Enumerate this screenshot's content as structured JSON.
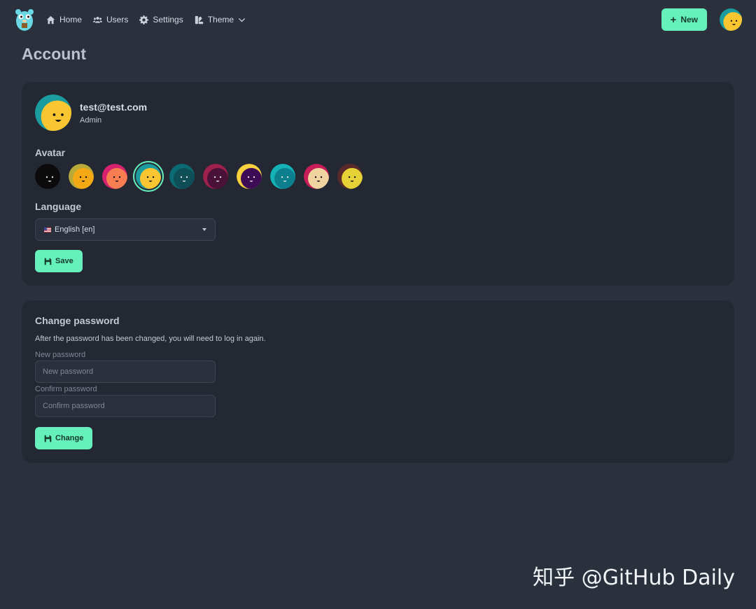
{
  "nav": {
    "logo_icon": "gopher-logo-icon",
    "items": [
      {
        "label": "Home",
        "icon": "home-icon"
      },
      {
        "label": "Users",
        "icon": "users-icon"
      },
      {
        "label": "Settings",
        "icon": "gear-icon"
      },
      {
        "label": "Theme",
        "icon": "palette-icon"
      }
    ],
    "new_button": "New",
    "accent_color": "#66f1bc"
  },
  "page": {
    "title": "Account"
  },
  "profile": {
    "email": "test@test.com",
    "role": "Admin"
  },
  "account": {
    "avatar_label": "Avatar",
    "avatars": [
      {
        "bg": "#0b0b0b",
        "face": "#0b0b0b",
        "accent": "#1a1a1a"
      },
      {
        "bg": "#b7a93a",
        "face": "#f4a814",
        "accent": "#8a8a2c"
      },
      {
        "bg": "#d6216e",
        "face": "#f77d52",
        "accent": "#b51a60"
      },
      {
        "bg": "#1b9da0",
        "face": "#f9c631",
        "accent": "#1b9da0"
      },
      {
        "bg": "#0c6b72",
        "face": "#0e4e57",
        "accent": "#0a8a8a"
      },
      {
        "bg": "#a0214b",
        "face": "#4a1238",
        "accent": "#7a1a45"
      },
      {
        "bg": "#f7d23e",
        "face": "#3e0b57",
        "accent": "#f7d23e"
      },
      {
        "bg": "#15b3b5",
        "face": "#0c7f8f",
        "accent": "#0c7f8f"
      },
      {
        "bg": "#c71e5a",
        "face": "#f1d3a0",
        "accent": "#c71e5a"
      },
      {
        "bg": "#5a2a2a",
        "face": "#e6d236",
        "accent": "#b0a12a"
      }
    ],
    "selected_avatar": 3,
    "language_label": "Language",
    "language_value": "English [en]",
    "save_button": "Save"
  },
  "password": {
    "title": "Change password",
    "hint": "After the password has been changed, you will need to log in again.",
    "new_label": "New password",
    "new_placeholder": "New password",
    "confirm_label": "Confirm password",
    "confirm_placeholder": "Confirm password",
    "change_button": "Change"
  },
  "watermark": "知乎 @GitHub Daily"
}
